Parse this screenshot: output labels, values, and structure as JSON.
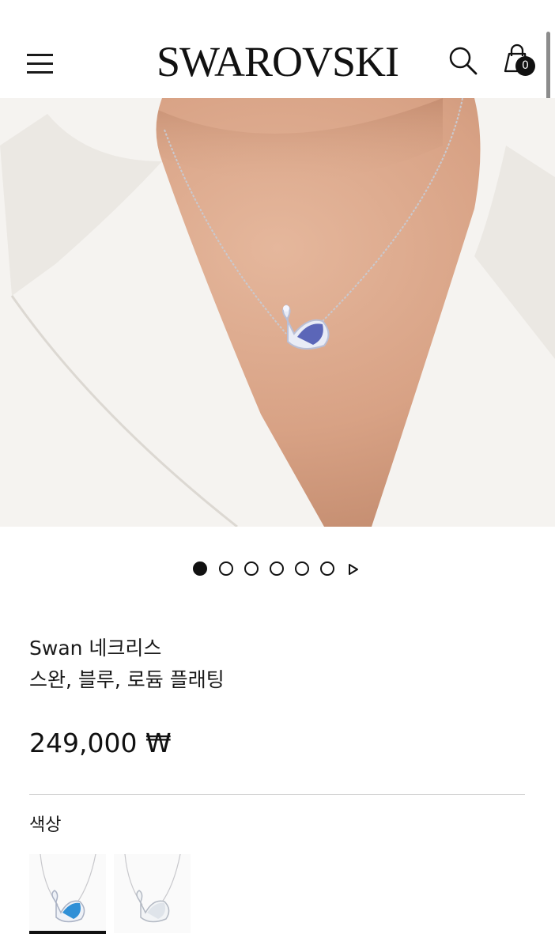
{
  "header": {
    "brand": "SWAROVSKI",
    "cart_count": "0",
    "icons": {
      "menu": "hamburger-menu-icon",
      "search": "search-icon",
      "cart": "shopping-bag-icon"
    }
  },
  "gallery": {
    "image": "woman-wearing-swan-necklace-photo",
    "slide_count": 6,
    "active_slide": 1
  },
  "product": {
    "title": "Swan 네크리스",
    "subtitle": "스완, 블루, 로듐 플래팅",
    "price": "249,000 ₩"
  },
  "color_section": {
    "label": "색상",
    "options": [
      {
        "name": "blue-swan-necklace-thumbnail",
        "selected": true
      },
      {
        "name": "white-swan-necklace-thumbnail",
        "selected": false
      }
    ]
  },
  "colors": {
    "accent": "#111111",
    "divider": "#cfcfcf",
    "skin": "#d9a88a",
    "blazer": "#f4f2ef"
  }
}
